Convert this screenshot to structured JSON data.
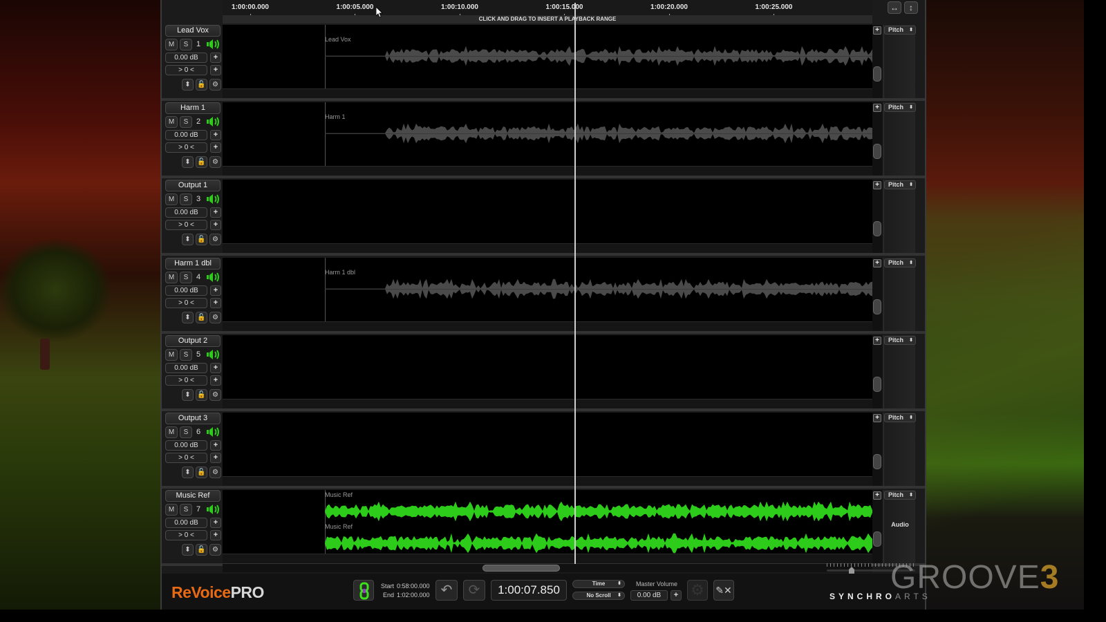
{
  "app": {
    "name_part1": "ReVoice",
    "name_part2": "PRO",
    "vendor_part1": "SYNCHRO",
    "vendor_part2": "ARTS"
  },
  "watermark": {
    "text": "GROOVE",
    "accent": "3"
  },
  "ruler": {
    "ticks": [
      "1:00:00.000",
      "1:00:05.000",
      "1:00:10.000",
      "1:00:15.000",
      "1:00:20.000",
      "1:00:25.000"
    ],
    "range_hint": "CLICK AND DRAG TO INSERT A PLAYBACK RANGE"
  },
  "top_buttons": {
    "fit_horizontal": "↔",
    "fit_vertical": "↕"
  },
  "tracks": [
    {
      "name": "Lead Vox",
      "number": "1",
      "mute": "M",
      "solo": "S",
      "gain": "0.00 dB",
      "pan": "> 0 <",
      "clip_label": "Lead Vox",
      "pitch": "Pitch",
      "wave_color": "#4a4a4a",
      "has_audio": true,
      "stereo": false,
      "panel_label": ""
    },
    {
      "name": "Harm 1",
      "number": "2",
      "mute": "M",
      "solo": "S",
      "gain": "0.00 dB",
      "pan": "> 0 <",
      "clip_label": "Harm 1",
      "pitch": "Pitch",
      "wave_color": "#4a4a4a",
      "has_audio": true,
      "stereo": false,
      "panel_label": ""
    },
    {
      "name": "Output 1",
      "number": "3",
      "mute": "M",
      "solo": "S",
      "gain": "0.00 dB",
      "pan": "> 0 <",
      "clip_label": "",
      "pitch": "Pitch",
      "wave_color": "#4a4a4a",
      "has_audio": false,
      "stereo": false,
      "panel_label": ""
    },
    {
      "name": "Harm 1 dbl",
      "number": "4",
      "mute": "M",
      "solo": "S",
      "gain": "0.00 dB",
      "pan": "> 0 <",
      "clip_label": "Harm 1 dbl",
      "pitch": "Pitch",
      "wave_color": "#4a4a4a",
      "has_audio": true,
      "stereo": false,
      "panel_label": ""
    },
    {
      "name": "Output 2",
      "number": "5",
      "mute": "M",
      "solo": "S",
      "gain": "0.00 dB",
      "pan": "> 0 <",
      "clip_label": "",
      "pitch": "Pitch",
      "wave_color": "#4a4a4a",
      "has_audio": false,
      "stereo": false,
      "panel_label": ""
    },
    {
      "name": "Output 3",
      "number": "6",
      "mute": "M",
      "solo": "S",
      "gain": "0.00 dB",
      "pan": "> 0 <",
      "clip_label": "",
      "pitch": "Pitch",
      "wave_color": "#4a4a4a",
      "has_audio": false,
      "stereo": false,
      "panel_label": ""
    },
    {
      "name": "Music Ref",
      "number": "7",
      "mute": "M",
      "solo": "S",
      "gain": "0.00 dB",
      "pan": "> 0 <",
      "clip_label": "Music Ref",
      "pitch": "Pitch",
      "wave_color": "#2ecc1a",
      "has_audio": true,
      "stereo": true,
      "panel_label": "Audio"
    }
  ],
  "transport": {
    "start_label": "Start",
    "start_value": "0:58:00.000",
    "end_label": "End",
    "end_value": "1:02:00.000",
    "timecode": "1:00:07.850",
    "display_mode": "Time",
    "scroll_mode": "No Scroll",
    "master_volume_label": "Master Volume",
    "master_volume_value": "0.00 dB"
  },
  "colors": {
    "accent_green": "#2ecc1a",
    "logo_orange": "#e86a14",
    "link_purple": "#9b30d0"
  }
}
